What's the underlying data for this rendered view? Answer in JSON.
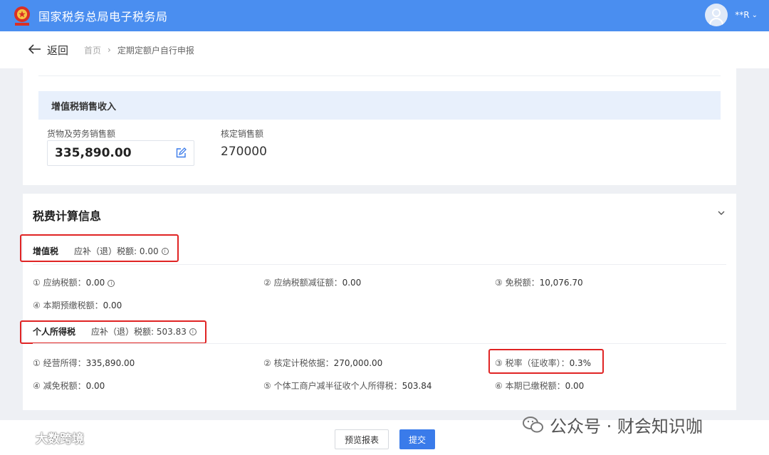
{
  "header": {
    "site_title": "国家税务总局电子税务局",
    "user_name": "**R",
    "user_caret": "⌄",
    "emblem_icon": "national-emblem-icon",
    "brand_color": "#4a8ef0"
  },
  "nav": {
    "back_label": "返回",
    "breadcrumb": [
      "首页",
      "定期定额户自行申报"
    ],
    "breadcrumb_sep": "›"
  },
  "vat_sales": {
    "section_title": "增值税销售收入",
    "goods_label": "货物及劳务销售额",
    "goods_value": "335,890.00",
    "verified_label": "核定销售额",
    "verified_value": "270000"
  },
  "tax_calc": {
    "title": "税费计算信息",
    "vat": {
      "name": "增值税",
      "due_label": "应补（退）税额: 0.00",
      "fields": [
        {
          "label": "① 应纳税额：",
          "value": "0.00"
        },
        {
          "label": "② 应纳税额减征额：",
          "value": "0.00"
        },
        {
          "label": "③ 免税额：",
          "value": "10,076.70"
        },
        {
          "label": "④ 本期预缴税额：",
          "value": "0.00"
        }
      ]
    },
    "iit": {
      "name": "个人所得税",
      "due_label": "应补（退）税额: 503.83",
      "fields": [
        {
          "label": "① 经营所得：",
          "value": "335,890.00"
        },
        {
          "label": "② 核定计税依据：",
          "value": "270,000.00"
        },
        {
          "label": "③ 税率（征收率）：",
          "value": "0.3%"
        },
        {
          "label": "④ 减免税额：",
          "value": "0.00"
        },
        {
          "label": "⑤ 个体工商户减半征收个人所得税：",
          "value": "503.84"
        },
        {
          "label": "⑥ 本期已缴税额：",
          "value": "0.00"
        }
      ]
    }
  },
  "footer": {
    "preview_label": "预览报表",
    "submit_label": "提交"
  },
  "watermarks": {
    "left": "大数跨境",
    "right": "公众号 · 财会知识咖"
  }
}
